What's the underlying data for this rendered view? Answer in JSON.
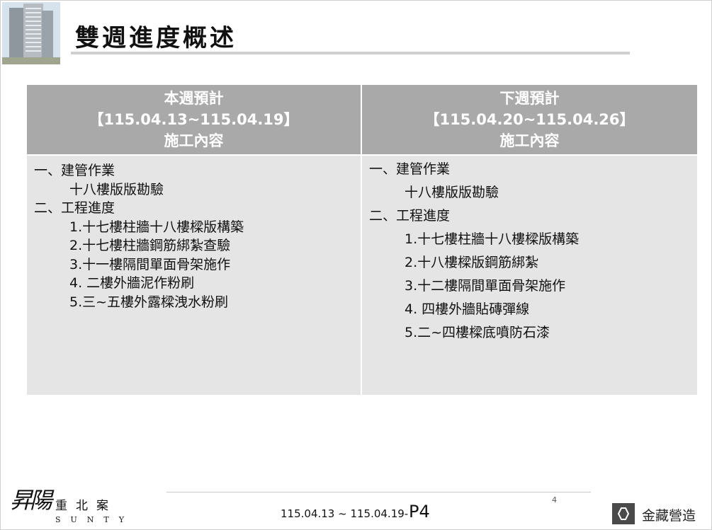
{
  "slide": {
    "title": "雙週進度概述"
  },
  "table": {
    "this_week": {
      "heading": "本週預計",
      "range": "【115.04.13~115.04.19】",
      "subheading": "施工內容",
      "items": [
        "一、建管作業",
        "十八樓版版勘驗",
        "二、工程進度",
        "1.十七樓柱牆十八樓樑版構築",
        "2.十七樓柱牆鋼筋綁紮查驗",
        "3.十一樓隔間單面骨架施作",
        "4. 二樓外牆泥作粉刷",
        "5.三~五樓外露樑洩水粉刷"
      ]
    },
    "next_week": {
      "heading": "下週預計",
      "range": "【115.04.20~115.04.26】",
      "subheading": "施工內容",
      "items": [
        "一、建管作業",
        "十八樓版版勘驗",
        "二、工程進度",
        "1.十七樓柱牆十八樓樑版構築",
        "2.十八樓樑版鋼筋綁紮",
        "3.十二樓隔間單面骨架施作",
        "4. 四樓外牆貼磚彈線",
        "5.二~四樓樑底噴防石漆"
      ]
    }
  },
  "footer": {
    "page_number": "4",
    "date_range": "115.04.13 ~ 115.04.19-",
    "page_label": "P4",
    "logo_left_chinese": "昇陽",
    "logo_left_sub": "重北案",
    "logo_left_english": "SUNTY",
    "logo_right": "金藏營造"
  }
}
